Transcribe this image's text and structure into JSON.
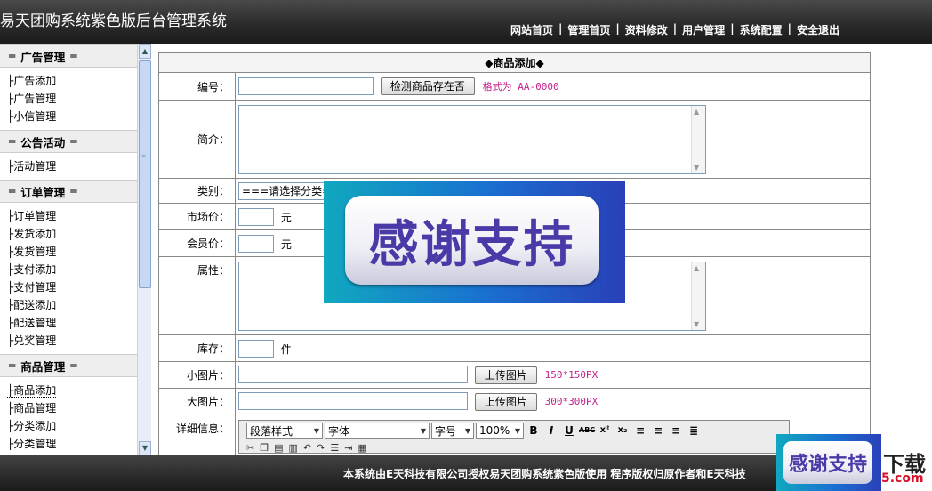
{
  "header": {
    "title": "易天团购系统紫色版后台管理系统",
    "nav": [
      "网站首页",
      "管理首页",
      "资料修改",
      "用户管理",
      "系统配置",
      "安全退出"
    ],
    "separator": "|"
  },
  "sidebar": {
    "groups": [
      {
        "title": "广告管理",
        "items": [
          "├广告添加",
          "├广告管理",
          "├小信管理"
        ]
      },
      {
        "title": "公告活动",
        "items": [
          "├活动管理"
        ]
      },
      {
        "title": "订单管理",
        "items": [
          "├订单管理",
          "├发货添加",
          "├发货管理",
          "├支付添加",
          "├支付管理",
          "├配送添加",
          "├配送管理",
          "├兑奖管理"
        ]
      },
      {
        "title": "商品管理",
        "items": [
          "├商品添加",
          "├商品管理",
          "├分类添加",
          "├分类管理"
        ]
      }
    ],
    "active_item": "├商品添加",
    "bars_glyph": "═"
  },
  "form": {
    "heading": "◆商品添加◆",
    "code": {
      "label": "编号：",
      "value": "",
      "button": "检测商品存在否",
      "hint": "格式为 AA-0000"
    },
    "intro": {
      "label": "简介：",
      "value": ""
    },
    "category": {
      "label": "类别：",
      "selected": "===请选择分类==="
    },
    "market_price": {
      "label": "市场价：",
      "value": "",
      "unit": "元"
    },
    "member_price": {
      "label": "会员价：",
      "value": "",
      "unit": "元"
    },
    "attributes": {
      "label": "属性：",
      "value": ""
    },
    "stock": {
      "label": "库存：",
      "value": "",
      "unit": "件"
    },
    "small_image": {
      "label": "小图片：",
      "value": "",
      "button": "上传图片",
      "hint": "150*150PX"
    },
    "large_image": {
      "label": "大图片：",
      "value": "",
      "button": "上传图片",
      "hint": "300*300PX"
    },
    "detail": {
      "label": "详细信息："
    }
  },
  "editor": {
    "paragraph_style": "段落样式",
    "font": "字体",
    "font_size": "字号",
    "zoom": "100%",
    "buttons": [
      "B",
      "I",
      "U",
      "ABC",
      "x²",
      "x₂"
    ]
  },
  "footer": {
    "text": "本系统由E天科技有限公司授权易天团购系统紫色版使用 程序版权归原作者和E天科技"
  },
  "overlay": {
    "text": "感谢支持",
    "watermark_top": "下载",
    "watermark_bottom": "5.com"
  },
  "colors": {
    "hint": "#c0238a",
    "header_bg": "#2b2b2b",
    "overlay_text": "#4a3aa8"
  }
}
